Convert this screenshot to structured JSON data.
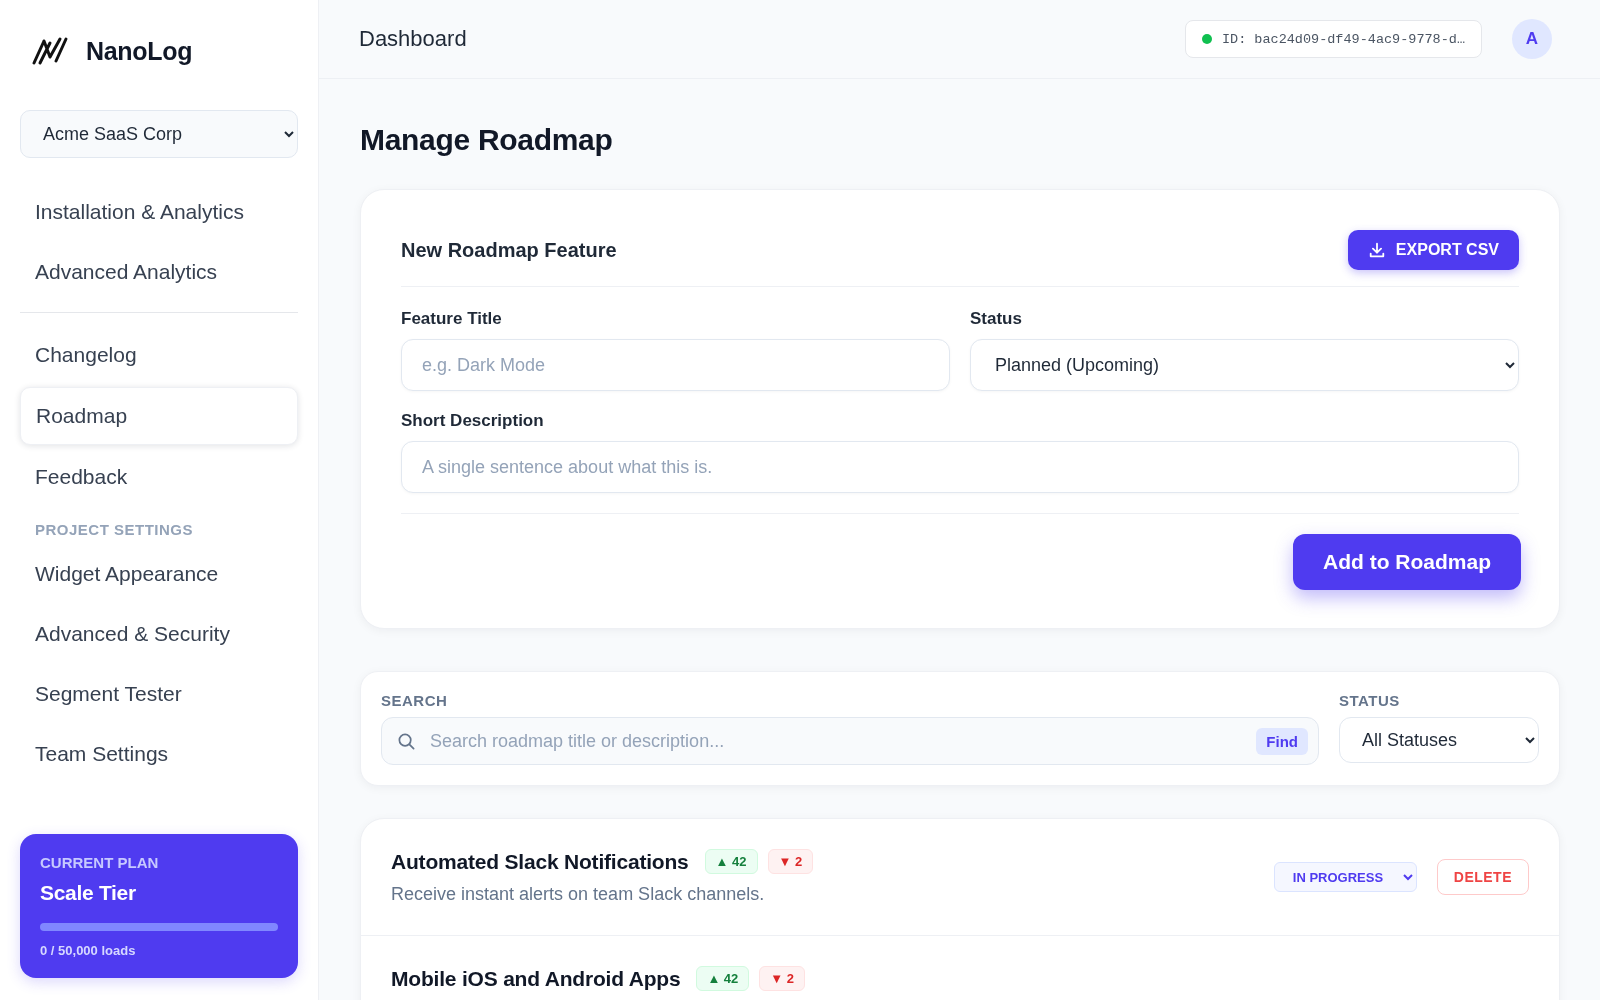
{
  "sidebar": {
    "brand": "NanoLog",
    "project_select": {
      "value": "Acme SaaS Corp"
    },
    "groups": [
      {
        "items": [
          {
            "label": "Installation & Analytics",
            "selected": false
          },
          {
            "label": "Advanced Analytics",
            "selected": false
          }
        ]
      },
      {
        "items": [
          {
            "label": "Changelog",
            "selected": false
          },
          {
            "label": "Roadmap",
            "selected": true
          },
          {
            "label": "Feedback",
            "selected": false
          }
        ]
      },
      {
        "heading": "PROJECT SETTINGS",
        "items": [
          {
            "label": "Widget Appearance",
            "selected": false
          },
          {
            "label": "Advanced & Security",
            "selected": false
          },
          {
            "label": "Segment Tester",
            "selected": false
          },
          {
            "label": "Team Settings",
            "selected": false
          }
        ]
      }
    ],
    "plan": {
      "label": "CURRENT PLAN",
      "name": "Scale Tier",
      "usage": "0 / 50,000 loads"
    }
  },
  "header": {
    "title": "Dashboard",
    "project_id": "ID: bac24d09-df49-4ac9-9778-d…",
    "avatar": "A"
  },
  "page_title": "Manage Roadmap",
  "form": {
    "title": "New Roadmap Feature",
    "export_button": "EXPORT CSV",
    "feature_title": {
      "label": "Feature Title",
      "placeholder": "e.g. Dark Mode"
    },
    "status": {
      "label": "Status",
      "value": "Planned (Upcoming)"
    },
    "description": {
      "label": "Short Description",
      "placeholder": "A single sentence about what this is."
    },
    "submit_button": "Add to Roadmap"
  },
  "filters": {
    "search_label": "SEARCH",
    "search_placeholder": "Search roadmap title or description...",
    "find_button": "Find",
    "status_label": "STATUS",
    "status_value": "All Statuses"
  },
  "features": [
    {
      "title": "Automated Slack Notifications",
      "upvotes": "▲ 42",
      "downvotes": "▼ 2",
      "description": "Receive instant alerts on team Slack channels.",
      "status": "IN PROGRESS",
      "delete": "DELETE"
    },
    {
      "title": "Mobile iOS and Android Apps",
      "upvotes": "▲ 42",
      "downvotes": "▼ 2"
    }
  ]
}
